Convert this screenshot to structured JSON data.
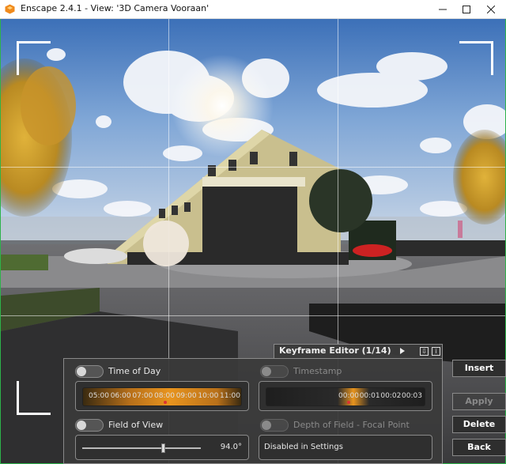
{
  "window": {
    "title": "Enscape 2.4.1 - View: '3D Camera Vooraan'"
  },
  "keyframe_editor": {
    "title": "Keyframe Editor (1/14)",
    "icon_names": [
      "play-icon",
      "export-icon",
      "info-icon"
    ]
  },
  "time_of_day": {
    "label": "Time of Day",
    "ticks": [
      "05:00",
      "06:00",
      "07:00",
      "08:00",
      "09:00",
      "10:00",
      "11:00"
    ]
  },
  "timestamp": {
    "label": "Timestamp",
    "ticks": [
      "00:00",
      "00:01",
      "00:02",
      "00:03"
    ]
  },
  "field_of_view": {
    "label": "Field of View",
    "value": "94.0°",
    "level": 0.68
  },
  "depth_of_field": {
    "label": "Depth of Field - Focal Point",
    "status": "Disabled in Settings"
  },
  "buttons": {
    "insert": "Insert",
    "apply": "Apply",
    "delete": "Delete",
    "back": "Back"
  },
  "colors": {
    "accent_orange": "#e8941e",
    "frame_green": "#2db34a"
  }
}
